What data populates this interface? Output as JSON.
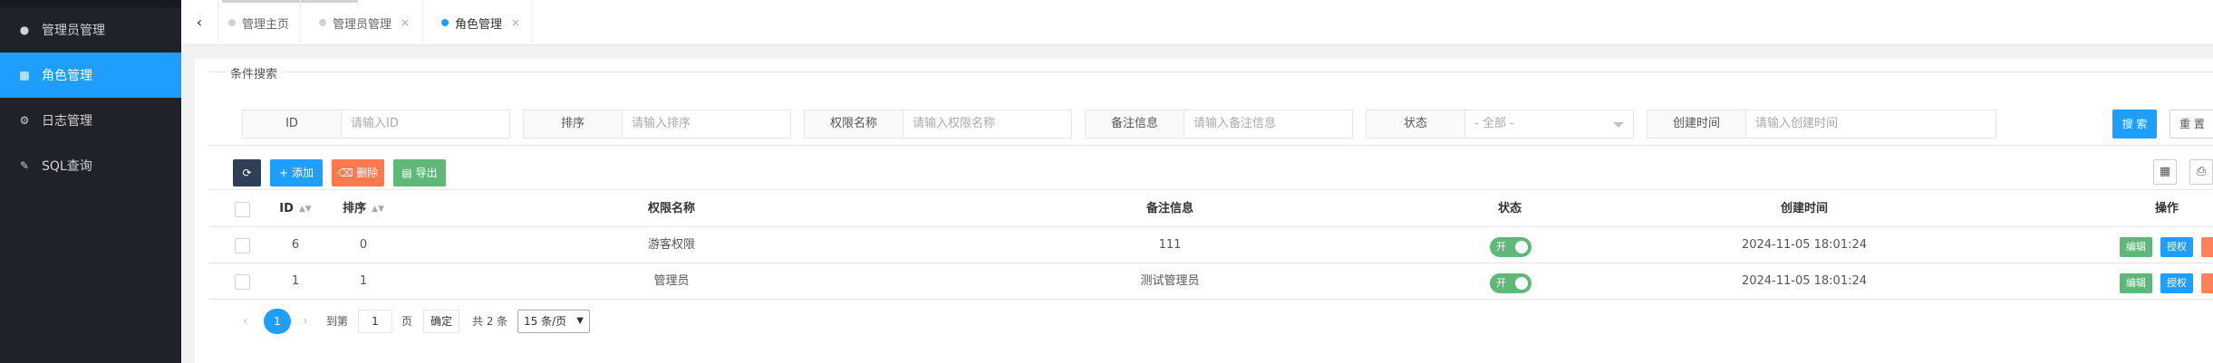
{
  "sidebar": {
    "items": [
      {
        "label": "管理员管理",
        "icon": "user-icon"
      },
      {
        "label": "角色管理",
        "icon": "role-icon",
        "active": true
      },
      {
        "label": "日志管理",
        "icon": "gear-icon"
      },
      {
        "label": "SQL查询",
        "icon": "chart-icon"
      }
    ]
  },
  "tabs": {
    "back_icon": "‹",
    "items": [
      {
        "label": "管理主页",
        "closable": false
      },
      {
        "label": "管理员管理",
        "closable": true
      },
      {
        "label": "角色管理",
        "closable": true,
        "active": true
      }
    ],
    "close_glyph": "×"
  },
  "search": {
    "legend": "条件搜索",
    "fields": [
      {
        "label": "ID",
        "placeholder": "请输入ID"
      },
      {
        "label": "排序",
        "placeholder": "请输入排序"
      },
      {
        "label": "权限名称",
        "placeholder": "请输入权限名称"
      },
      {
        "label": "备注信息",
        "placeholder": "请输入备注信息"
      },
      {
        "label": "状态",
        "value": "- 全部 -"
      },
      {
        "label": "创建时间",
        "placeholder": "请输入创建时间"
      }
    ],
    "search_label": "搜 索",
    "reset_label": "重 置"
  },
  "toolbar": {
    "add_label": "添加",
    "delete_label": "删除",
    "export_label": "导出"
  },
  "table": {
    "headers": {
      "id": "ID",
      "sort": "排序",
      "name": "权限名称",
      "remark": "备注信息",
      "status": "状态",
      "created": "创建时间",
      "actions": "操作"
    },
    "rows": [
      {
        "id": "6",
        "sort": "0",
        "name": "游客权限",
        "remark": "111",
        "status": "开",
        "created": "2024-11-05 18:01:24",
        "edit": "编辑",
        "auth": "授权"
      },
      {
        "id": "1",
        "sort": "1",
        "name": "管理员",
        "remark": "测试管理员",
        "status": "开",
        "created": "2024-11-05 18:01:24",
        "edit": "编辑",
        "auth": "授权"
      }
    ]
  },
  "pager": {
    "prev": "‹",
    "current": "1",
    "next": "›",
    "goto_label": "到第",
    "page_input": "1",
    "page_suffix": "页",
    "ok_label": "确定",
    "total": "共 2 条",
    "page_size": "15 条/页"
  },
  "colors": {
    "accent": "#1e9fff",
    "sidebar_bg": "#20222a",
    "success": "#5fb878",
    "danger": "#ff5722",
    "dark": "#2f4056"
  }
}
